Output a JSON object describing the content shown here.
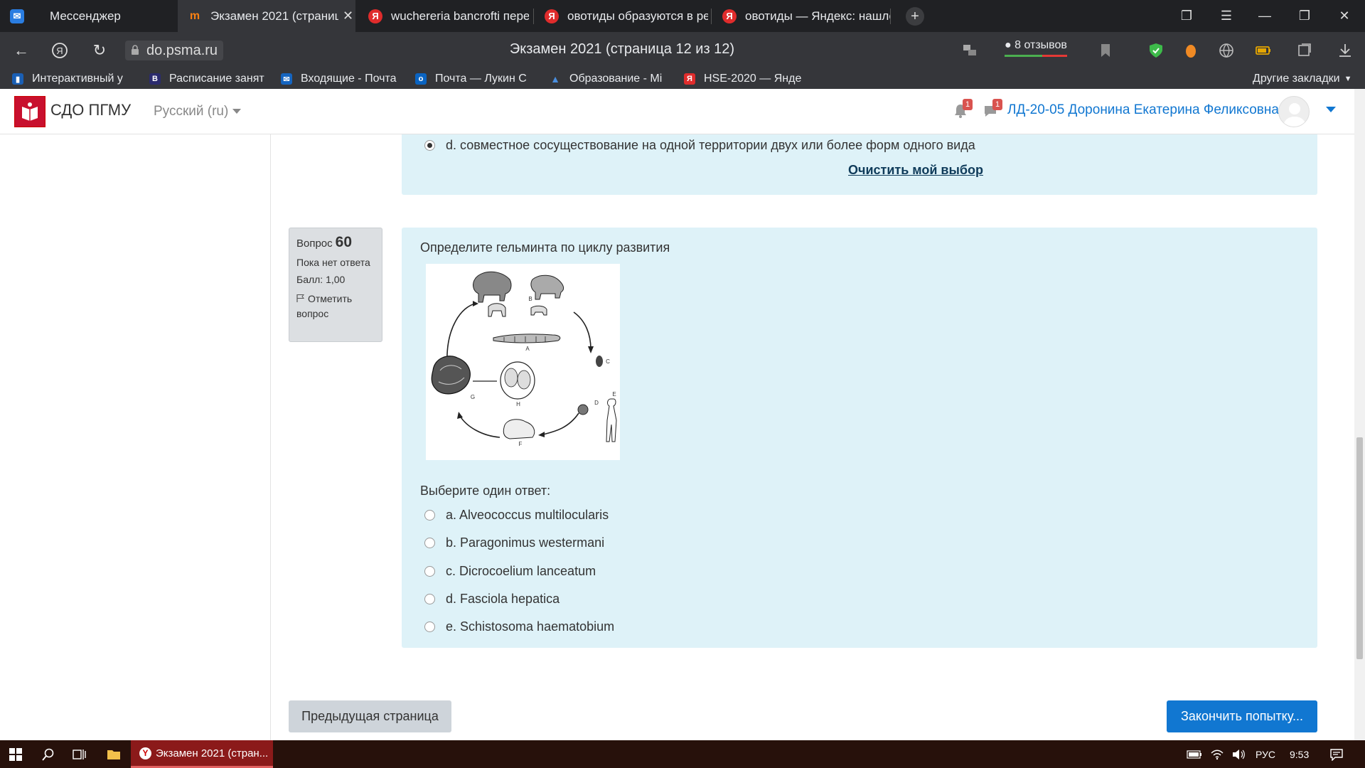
{
  "browser": {
    "tabs": [
      {
        "label": "Мессенджер",
        "icon": "messenger-icon"
      },
      {
        "label": "Экзамен 2021 (страниц",
        "icon": "moodle-icon",
        "active": true
      },
      {
        "label": "wuchereria bancrofti пере",
        "icon": "yandex-icon"
      },
      {
        "label": "овотиды образуются в ре",
        "icon": "yandex-icon"
      },
      {
        "label": "овотиды — Яндекс: нашло",
        "icon": "yandex-icon"
      }
    ],
    "url": "do.psma.ru",
    "page_title": "Экзамен 2021 (страница 12 из 12)",
    "reviews": "8 отзывов",
    "bookmarks": [
      "Интерактивный у",
      "Расписание занят",
      "Входящие - Почта",
      "Почта — Лукин С",
      "Образование - Mi",
      "HSE-2020 — Янде"
    ],
    "other_bookmarks": "Другие закладки"
  },
  "site": {
    "name": "СДО ПГМУ",
    "language": "Русский (ru)",
    "notifications_count": "1",
    "messages_count": "1",
    "user": "ЛД-20-05 Доронина Екатерина Феликсовна"
  },
  "prev_question": {
    "selected_option": "d. совместное сосуществование на одной территории двух или более форм одного вида",
    "clear_label": "Очистить мой выбор"
  },
  "question": {
    "label": "Вопрос",
    "number": "60",
    "status": "Пока нет ответа",
    "score": "Балл: 1,00",
    "flag_label": "Отметить вопрос",
    "text": "Определите гельминта по циклу развития",
    "prompt": "Выберите один ответ:",
    "options": [
      "a. Alveococcus multilocularis",
      "b. Paragonimus westermani",
      "c. Dicrocoelium lanceatum",
      "d. Fasciola hepatica",
      "e. Schistosoma haematobium"
    ],
    "diagram_letters": [
      "A",
      "B",
      "C",
      "D",
      "E",
      "F",
      "G",
      "H"
    ]
  },
  "nav": {
    "prev_label": "Предыдущая страница",
    "finish_label": "Закончить попытку..."
  },
  "taskbar": {
    "app_label": "Экзамен 2021 (стран...",
    "lang": "РУС",
    "time": "9:53"
  },
  "colors": {
    "accent": "#1177d1",
    "answer_bg": "#def2f8",
    "browser_dark": "#202124"
  }
}
